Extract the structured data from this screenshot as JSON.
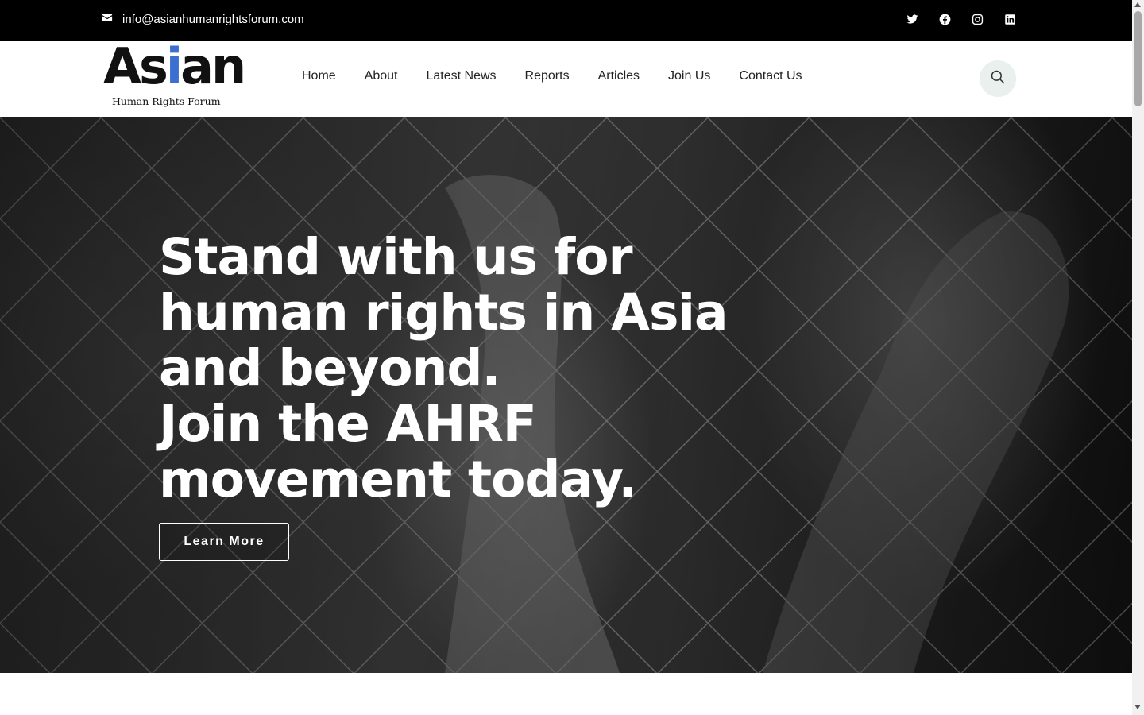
{
  "topbar": {
    "email": "info@asianhumanrightsforum.com",
    "socials": [
      "twitter-icon",
      "facebook-icon",
      "instagram-icon",
      "linkedin-icon"
    ]
  },
  "logo": {
    "word_before": "As",
    "word_i": "i",
    "word_after": "an",
    "tagline": "Human Rights Forum",
    "accent_color": "#3b6fd0"
  },
  "nav": {
    "items": [
      {
        "label": "Home"
      },
      {
        "label": "About"
      },
      {
        "label": "Latest News"
      },
      {
        "label": "Reports"
      },
      {
        "label": "Articles"
      },
      {
        "label": "Join Us"
      },
      {
        "label": "Contact Us"
      }
    ]
  },
  "hero": {
    "headline_lines": [
      "Stand with us for",
      "human rights in Asia",
      "and beyond.",
      "Join the AHRF",
      "movement today."
    ],
    "cta_label": "Learn More"
  }
}
